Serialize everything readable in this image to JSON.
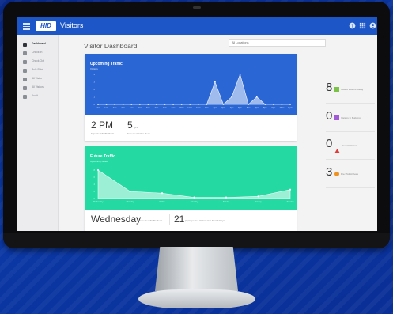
{
  "topbar": {
    "logo_text": "HID",
    "app_title": "Visitors",
    "icons": [
      "menu-icon",
      "help-icon",
      "apps-grid-icon",
      "account-icon"
    ]
  },
  "sidebar": {
    "items": [
      {
        "label": "Dashboard",
        "icon": "dashboard-icon",
        "active": true
      },
      {
        "label": "Check In",
        "icon": "check-in-icon"
      },
      {
        "label": "Check Out",
        "icon": "check-out-icon"
      },
      {
        "label": "Bulk Print",
        "icon": "print-icon"
      },
      {
        "label": "All Visits",
        "icon": "visits-icon"
      },
      {
        "label": "All Visitors",
        "icon": "visitors-icon"
      },
      {
        "label": "Audit",
        "icon": "audit-icon"
      }
    ]
  },
  "main": {
    "title": "Visitor Dashboard",
    "location_value": "All Locations"
  },
  "upcoming": {
    "title": "Upcoming Traffic",
    "subtitle": "Visitors",
    "peak_time": "2 PM",
    "peak_label": "Expected Traffic Peak",
    "active_count": "5",
    "active_unit": "yrs",
    "active_label": "Expected Active Peak",
    "color": "#2a66d4"
  },
  "future": {
    "title": "Future Traffic",
    "subtitle": "Upcoming Week",
    "peak_day": "Wednesday",
    "peak_label": "Expected Traffic Peak",
    "count": "21",
    "count_label": "(L) Expected Visitors For Next 7 Days",
    "color": "#25d9a3",
    "day_labels": [
      "Wednesday",
      "Thursday",
      "Friday",
      "Saturday",
      "Sunday",
      "Monday",
      "Tuesday"
    ]
  },
  "stats": [
    {
      "value": "8",
      "label": "Invited Visitors Today",
      "color": "#7cc24a",
      "shape": "square"
    },
    {
      "value": "0",
      "label": "Visitors In Building",
      "color": "#a25bd6",
      "shape": "square"
    },
    {
      "value": "0",
      "label": "Overall Alarms",
      "color": "#e23b3b",
      "shape": "triangle"
    },
    {
      "value": "3",
      "label": "Pre-Visit Arrivals",
      "color": "#f0921f",
      "shape": "circle"
    }
  ],
  "chart_data": [
    {
      "type": "area",
      "title": "Upcoming Traffic",
      "ylabel": "Visitors",
      "x": [
        "12am",
        "1am",
        "2am",
        "3am",
        "4am",
        "5am",
        "6am",
        "7am",
        "8am",
        "9am",
        "10am",
        "11am",
        "12pm",
        "1pm",
        "2pm",
        "3pm",
        "4pm",
        "5pm",
        "6pm",
        "7pm",
        "8pm",
        "9pm",
        "10pm",
        "11pm"
      ],
      "values": [
        0,
        0,
        0,
        0,
        0,
        0,
        0,
        0,
        0,
        0,
        0,
        0,
        0,
        0,
        3,
        0,
        1,
        4,
        0,
        1,
        0,
        0,
        0,
        0
      ]
    },
    {
      "type": "area",
      "title": "Future Traffic",
      "x": [
        "Wednesday",
        "Thursday",
        "Friday",
        "Saturday",
        "Sunday",
        "Monday",
        "Tuesday"
      ],
      "values": [
        8,
        2,
        1.5,
        0.3,
        0.3,
        0.6,
        2.5
      ]
    }
  ]
}
